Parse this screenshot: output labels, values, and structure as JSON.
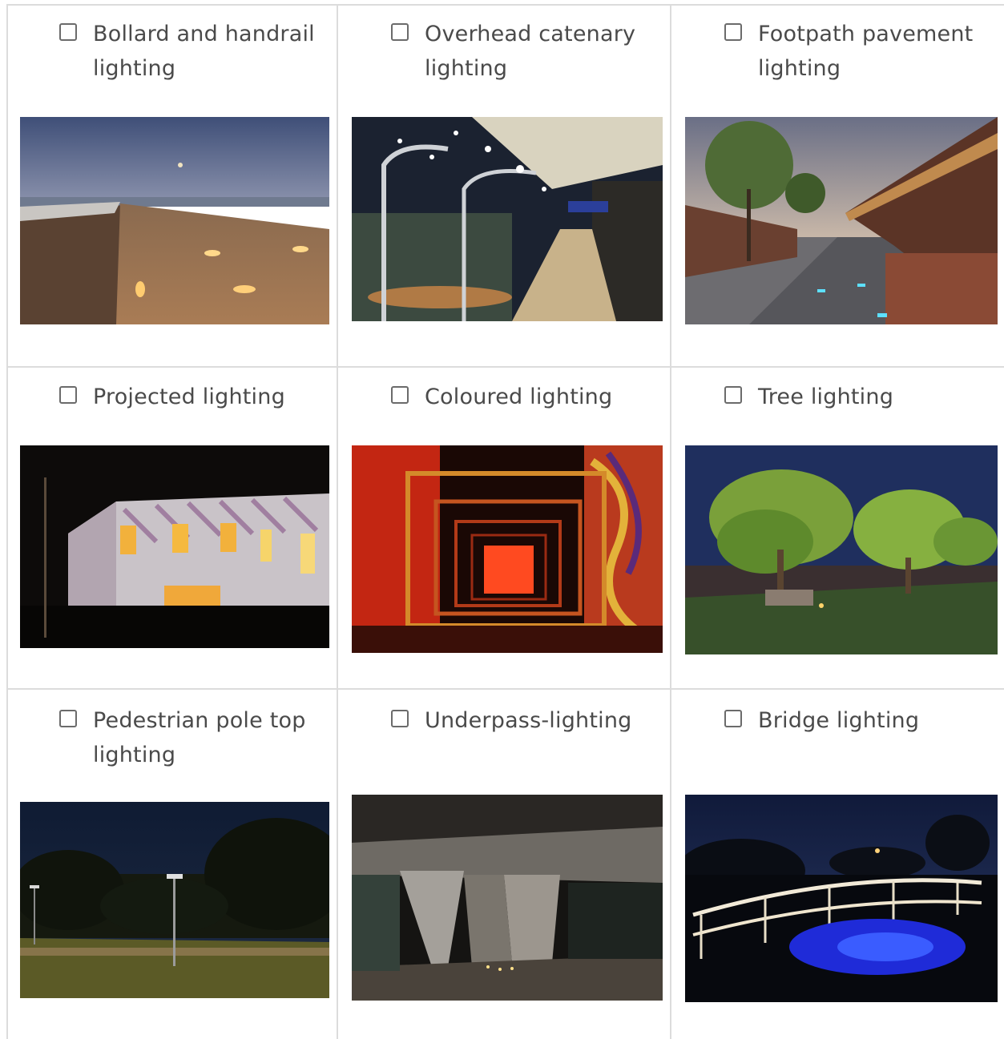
{
  "options": [
    {
      "label": "Bollard and handrail lighting",
      "checked": false,
      "photo": "boardwalk-bollard-photo"
    },
    {
      "label": "Overhead catenary lighting",
      "checked": false,
      "photo": "street-catenary-photo"
    },
    {
      "label": "Footpath pavement lighting",
      "checked": false,
      "photo": "footpath-pavement-photo"
    },
    {
      "label": "Projected lighting",
      "checked": false,
      "photo": "projected-building-photo"
    },
    {
      "label": "Coloured lighting",
      "checked": false,
      "photo": "red-frames-photo"
    },
    {
      "label": "Tree lighting",
      "checked": false,
      "photo": "uplit-trees-photo"
    },
    {
      "label": "Pedestrian pole top lighting",
      "checked": false,
      "photo": "park-pole-photo"
    },
    {
      "label": "Underpass-lighting",
      "checked": false,
      "photo": "underpass-photo"
    },
    {
      "label": "Bridge lighting",
      "checked": false,
      "photo": "bridge-photo"
    }
  ],
  "colors": {
    "checkbox_border": "#6b6b6b",
    "label_text": "#4a4a4a",
    "grid_line": "#dcdcdc"
  }
}
